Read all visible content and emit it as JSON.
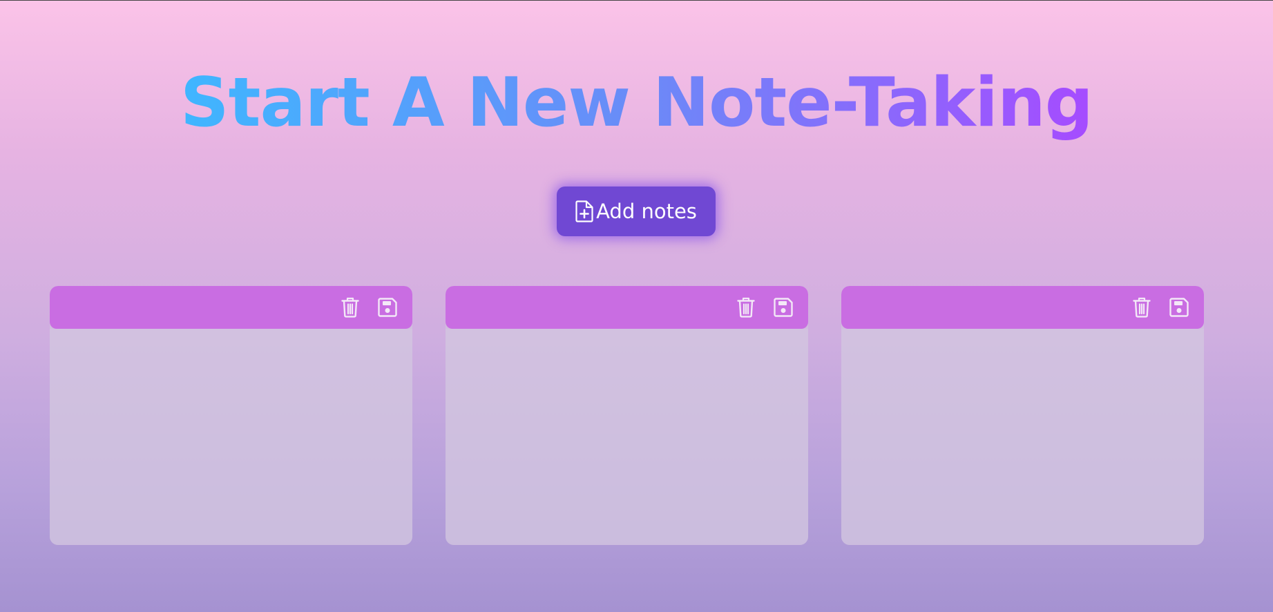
{
  "page": {
    "title": "Start A New Note-Taking"
  },
  "toolbar": {
    "add_label": "Add notes",
    "add_icon": "file-plus-icon"
  },
  "notes": [
    {
      "delete_icon": "trash-icon",
      "save_icon": "floppy-disk-icon",
      "content": ""
    },
    {
      "delete_icon": "trash-icon",
      "save_icon": "floppy-disk-icon",
      "content": ""
    },
    {
      "delete_icon": "trash-icon",
      "save_icon": "floppy-disk-icon",
      "content": ""
    }
  ],
  "colors": {
    "title_gradient_start": "#3fb6ff",
    "title_gradient_end": "#a64bff",
    "button_bg": "#7048d3",
    "note_header_bg": "#c96de2",
    "background_top": "#fbc3e8",
    "background_bottom": "#a592d1"
  }
}
